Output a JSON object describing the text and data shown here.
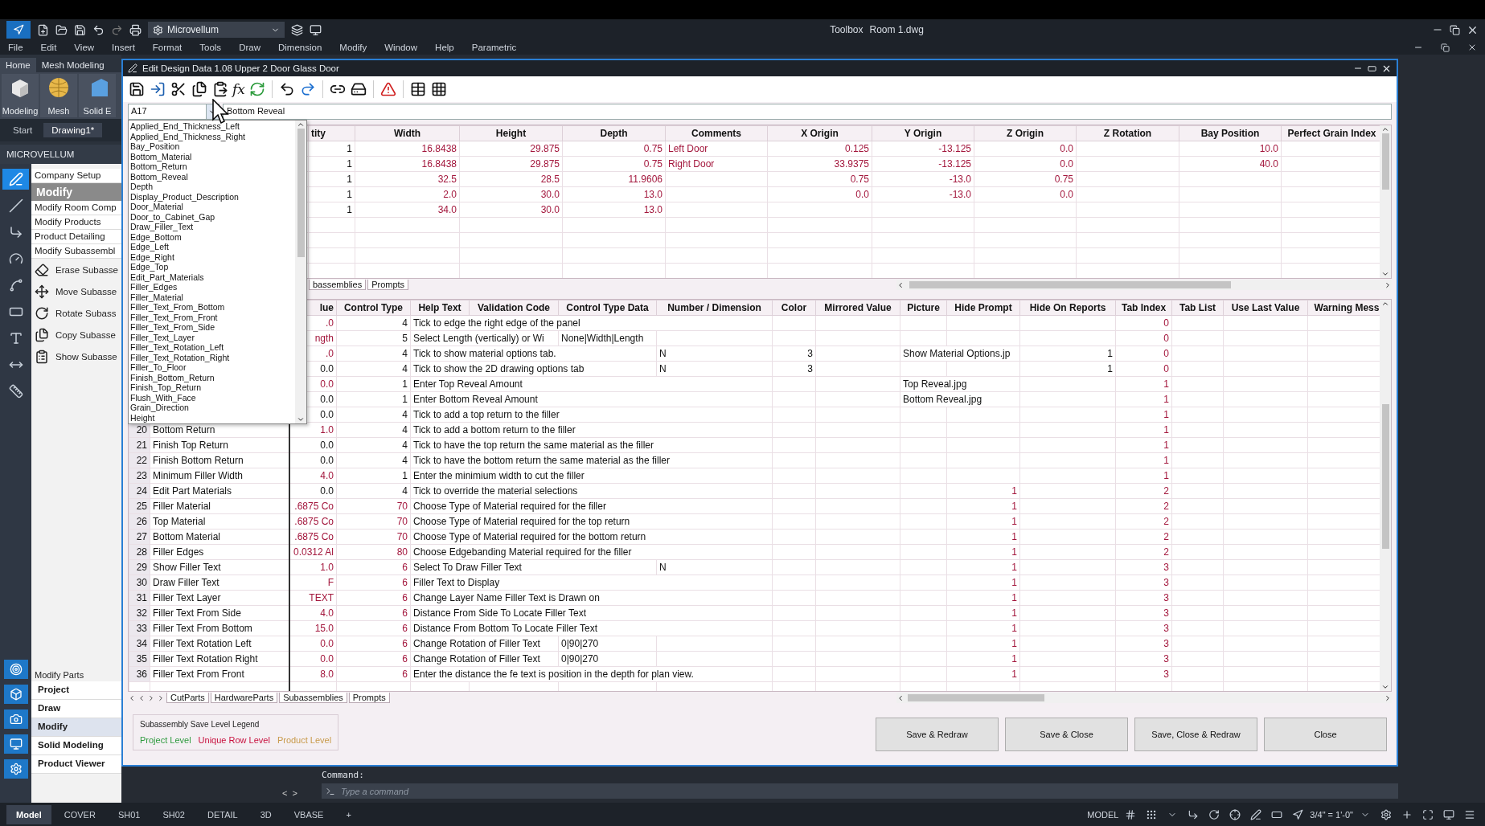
{
  "app": {
    "workspace": "Microvellum",
    "toolbox_label": "Toolbox",
    "document": "Room 1.dwg"
  },
  "menu": [
    "File",
    "Edit",
    "View",
    "Insert",
    "Format",
    "Tools",
    "Draw",
    "Dimension",
    "Modify",
    "Window",
    "Help",
    "Parametric"
  ],
  "ribbon": {
    "tabs": [
      {
        "label": "Home",
        "selected": true
      },
      {
        "label": "Mesh Modeling",
        "selected": false
      }
    ],
    "buttons": [
      "Modeling",
      "Mesh",
      "Solid E"
    ]
  },
  "file_tabs": [
    {
      "label": "Start",
      "selected": false
    },
    {
      "label": "Drawing1*",
      "selected": true
    }
  ],
  "palette": {
    "title": "MICROVELLUM",
    "items": [
      {
        "kind": "link",
        "label": "Company Setup"
      },
      {
        "kind": "header",
        "label": "Modify"
      },
      {
        "kind": "link",
        "label": "Modify Room Comp"
      },
      {
        "kind": "link",
        "label": "Modify Products"
      },
      {
        "kind": "link",
        "label": "Product Detailing"
      },
      {
        "kind": "link",
        "label": "Modify Subassembl"
      },
      {
        "kind": "tool",
        "label": "Erase Subasse"
      },
      {
        "kind": "tool",
        "label": "Move Subasse"
      },
      {
        "kind": "tool",
        "label": "Rotate Subass"
      },
      {
        "kind": "tool",
        "label": "Copy Subasse"
      },
      {
        "kind": "tool",
        "label": "Show Subasse"
      }
    ],
    "footer_label": "Modify Parts",
    "groups": [
      {
        "label": "Project",
        "selected": false
      },
      {
        "label": "Draw",
        "selected": false
      },
      {
        "label": "Modify",
        "selected": true
      },
      {
        "label": "Solid Modeling",
        "selected": false
      },
      {
        "label": "Product Viewer",
        "selected": false
      }
    ],
    "scroll_arrows": [
      "<",
      ">"
    ]
  },
  "dialog": {
    "title": "Edit Design Data 1.08 Upper 2 Door Glass Door",
    "formula_label": "fx",
    "cell_ref": "A17",
    "cell_value": "Bottom Reveal",
    "dropdown": [
      "Applied_End_Thickness_Left",
      "Applied_End_Thickness_Right",
      "Bay_Position",
      "Bottom_Material",
      "Bottom_Return",
      "Bottom_Reveal",
      "Depth",
      "Display_Product_Description",
      "Door_Material",
      "Door_to_Cabinet_Gap",
      "Draw_Filler_Text",
      "Edge_Bottom",
      "Edge_Left",
      "Edge_Right",
      "Edge_Top",
      "Edit_Part_Materials",
      "Filler_Edges",
      "Filler_Material",
      "Filler_Text_From_Bottom",
      "Filler_Text_From_Front",
      "Filler_Text_From_Side",
      "Filler_Text_Layer",
      "Filler_Text_Rotation_Left",
      "Filler_Text_Rotation_Right",
      "Filler_To_Floor",
      "Finish_Bottom_Return",
      "Finish_Top_Return",
      "Flush_With_Face",
      "Grain_Direction",
      "Height"
    ],
    "top_grid": {
      "columns": [
        "tity",
        "Width",
        "Height",
        "Depth",
        "Comments",
        "X Origin",
        "Y Origin",
        "Z Origin",
        "Z Rotation",
        "Bay Position",
        "Perfect Grain Index"
      ],
      "rows": [
        [
          "1",
          "16.8438",
          "29.875",
          "0.75",
          "Left Door",
          "0.125",
          "-13.125",
          "0.0",
          null,
          "10.0",
          null
        ],
        [
          "1",
          "16.8438",
          "29.875",
          "0.75",
          "Right Door",
          "33.9375",
          "-13.125",
          "0.0",
          null,
          "40.0",
          null
        ],
        [
          "1",
          "32.5",
          "28.5",
          "11.9606",
          null,
          "0.75",
          "-13.0",
          "0.75",
          null,
          null,
          null
        ],
        [
          "1",
          "2.0",
          "30.0",
          "13.0",
          null,
          "0.0",
          "-13.0",
          "0.0",
          null,
          null,
          null
        ],
        [
          "1",
          "34.0",
          "30.0",
          "13.0",
          null,
          null,
          null,
          null,
          null,
          null,
          null
        ]
      ]
    },
    "top_sheet_tabs": [
      "bassemblies",
      "Prompts"
    ],
    "prompts_grid": {
      "columns": [
        "lue",
        "Control Type",
        "Help Text",
        "Validation Code",
        "Control Type Data",
        "Number / Dimension",
        "Color",
        "Mirrored Value",
        "Picture",
        "Hide Prompt",
        "Hide On Reports",
        "Tab Index",
        "Tab List",
        "Use Last Value",
        "Warning Mess"
      ],
      "rows": [
        {
          "value": ".0",
          "value_unique": true,
          "type": "4",
          "type_unique": false,
          "help": "Tick to edge the right edge of the panel",
          "tab_index": "0"
        },
        {
          "value": "ngth",
          "value_unique": true,
          "type": "5",
          "type_unique": false,
          "help": "Select Length (vertically) or Wi",
          "ct_data": "None|Width|Length",
          "tab_index": "0"
        },
        {
          "value": ".0",
          "value_unique": true,
          "type": "4",
          "type_unique": false,
          "help": "Tick to show material options tab.",
          "num_dim": "N",
          "color_value": "3",
          "picture": "Show Material Options.jp",
          "hide_reports": "1",
          "tab_index": "0"
        },
        {
          "value": "0.0",
          "value_unique": false,
          "type": "4",
          "type_unique": false,
          "help": "Tick to show the 2D drawing options tab",
          "num_dim": "N",
          "color_value": "3",
          "hide_reports": "1",
          "tab_index": "0"
        },
        {
          "value": "0.0",
          "value_unique": true,
          "type": "1",
          "type_unique": false,
          "help": "Enter Top Reveal Amount",
          "picture": "Top Reveal.jpg",
          "tab_index": "1"
        },
        {
          "value": "0.0",
          "value_unique": false,
          "type": "1",
          "type_unique": false,
          "help": "Enter Bottom Reveal Amount",
          "picture": "Bottom Reveal.jpg",
          "tab_index": "1"
        },
        {
          "value": "0.0",
          "value_unique": false,
          "type": "4",
          "type_unique": false,
          "help": "Tick to add a top return to the filler",
          "tab_index": "1"
        },
        {
          "n": "20",
          "name": "Bottom Return",
          "value": "1.0",
          "value_unique": true,
          "type": "4",
          "type_unique": false,
          "help": "Tick to add a bottom return to the filler",
          "tab_index": "1"
        },
        {
          "n": "21",
          "name": "Finish Top Return",
          "value": "0.0",
          "value_unique": false,
          "type": "4",
          "type_unique": false,
          "help": "Tick to have the top return the same material as the filler",
          "tab_index": "1"
        },
        {
          "n": "22",
          "name": "Finish Bottom Return",
          "value": "0.0",
          "value_unique": false,
          "type": "4",
          "type_unique": false,
          "help": "Tick to have the bottom return the same material as the filler",
          "tab_index": "1"
        },
        {
          "n": "23",
          "name": "Minimum Filler Width",
          "value": "4.0",
          "value_unique": true,
          "type": "1",
          "type_unique": false,
          "help": "Enter the minimium width to cut the filler",
          "tab_index": "1"
        },
        {
          "n": "24",
          "name": "Edit Part Materials",
          "value": "0.0",
          "value_unique": false,
          "type": "4",
          "type_unique": false,
          "help": "Tick to override the material selections",
          "hide_prompt": "1",
          "tab_index": "2"
        },
        {
          "n": "25",
          "name": "Filler Material",
          "value": ".6875 Co",
          "value_unique": true,
          "type": "70",
          "type_unique": true,
          "help": "Choose Type of Material required for the filler",
          "hide_prompt": "1",
          "tab_index": "2"
        },
        {
          "n": "26",
          "name": "Top Material",
          "value": ".6875 Co",
          "value_unique": true,
          "type": "70",
          "type_unique": true,
          "help": "Choose Type of Material required for the top return",
          "hide_prompt": "1",
          "tab_index": "2"
        },
        {
          "n": "27",
          "name": "Bottom Material",
          "value": ".6875 Co",
          "value_unique": true,
          "type": "70",
          "type_unique": true,
          "help": "Choose Type of Material required for the bottom return",
          "hide_prompt": "1",
          "tab_index": "2"
        },
        {
          "n": "28",
          "name": "Filler Edges",
          "value": "0.0312 Al",
          "value_unique": true,
          "type": "80",
          "type_unique": true,
          "help": "Choose Edgebanding Material required for the filler",
          "hide_prompt": "1",
          "tab_index": "2"
        },
        {
          "n": "29",
          "name": "Show Filler Text",
          "value": "1.0",
          "value_unique": true,
          "type": "6",
          "type_unique": true,
          "help": "Select To Draw Filler Text",
          "num_dim": "N",
          "hide_prompt": "1",
          "tab_index": "3"
        },
        {
          "n": "30",
          "name": "Draw Filler Text",
          "value": "F",
          "value_unique": true,
          "type": "6",
          "type_unique": true,
          "help": "Filler Text to Display",
          "hide_prompt": "1",
          "tab_index": "3"
        },
        {
          "n": "31",
          "name": "Filler Text Layer",
          "value": "TEXT",
          "value_unique": true,
          "type": "6",
          "type_unique": true,
          "help": "Change Layer Name Filler Text is Drawn on",
          "hide_prompt": "1",
          "tab_index": "3"
        },
        {
          "n": "32",
          "name": "Filler Text From Side",
          "value": "4.0",
          "value_unique": true,
          "type": "6",
          "type_unique": true,
          "help": "Distance From Side To Locate Filler Text",
          "hide_prompt": "1",
          "tab_index": "3"
        },
        {
          "n": "33",
          "name": "Filler Text From Bottom",
          "value": "15.0",
          "value_unique": true,
          "type": "6",
          "type_unique": true,
          "help": "Distance From Bottom To Locate Filler Text",
          "hide_prompt": "1",
          "tab_index": "3"
        },
        {
          "n": "34",
          "name": "Filler Text Rotation Left",
          "value": "0.0",
          "value_unique": true,
          "type": "6",
          "type_unique": true,
          "help": "Change Rotation of Filler Text",
          "ct_data": "0|90|270",
          "hide_prompt": "1",
          "tab_index": "3"
        },
        {
          "n": "35",
          "name": "Filler Text Rotation Right",
          "value": "0.0",
          "value_unique": true,
          "type": "6",
          "type_unique": true,
          "help": "Change Rotation of Filler Text",
          "ct_data": "0|90|270",
          "hide_prompt": "1",
          "tab_index": "3"
        },
        {
          "n": "36",
          "name": "Filler Text From Front",
          "value": "8.0",
          "value_unique": true,
          "type": "6",
          "type_unique": true,
          "help": "Enter the distance the fe text is position in the depth for plan view.",
          "hide_prompt": "1",
          "tab_index": "3"
        }
      ]
    },
    "sheet_tabs": [
      "CutParts",
      "HardwareParts",
      "Subassemblies",
      "Prompts"
    ],
    "legend": {
      "title": "Subassembly Save Level Legend",
      "levels": [
        {
          "label": "Project Level",
          "color": "#2e9a3e"
        },
        {
          "label": "Unique Row Level",
          "color": "#c8103e"
        },
        {
          "label": "Product Level",
          "color": "#c89a4a"
        }
      ]
    },
    "buttons": [
      "Save & Redraw",
      "Save & Close",
      "Save, Close & Redraw",
      "Close"
    ]
  },
  "command": {
    "label": "Command:",
    "placeholder": "Type a command"
  },
  "layout_tabs": [
    {
      "label": "Model",
      "selected": true
    },
    {
      "label": "COVER",
      "selected": false
    },
    {
      "label": "SH01",
      "selected": false
    },
    {
      "label": "SH02",
      "selected": false
    },
    {
      "label": "DETAIL",
      "selected": false
    },
    {
      "label": "3D",
      "selected": false
    },
    {
      "label": "VBASE",
      "selected": false
    }
  ],
  "add_tab": "+",
  "status": {
    "space": "MODEL",
    "scale": "3/4\" = 1'-0\""
  }
}
